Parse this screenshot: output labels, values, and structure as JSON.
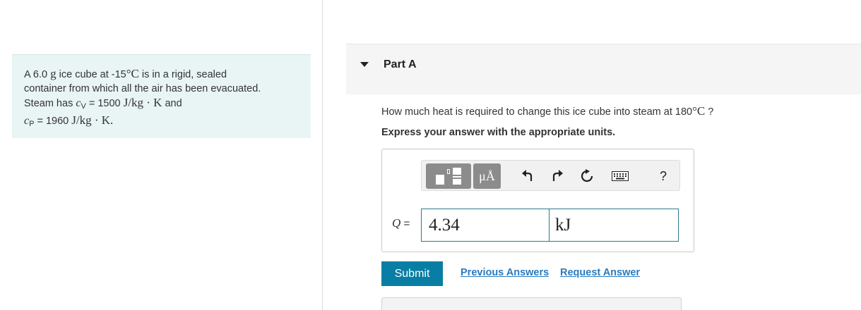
{
  "problem": {
    "line1_pre": "A 6.0",
    "line1_mass_unit": "g",
    "line1_mid": "ice cube at -15",
    "line1_temp_unit": "°C",
    "line1_post": "is in a rigid, sealed",
    "line2": "container from which all the air has been evacuated.",
    "line3_pre": "Steam has",
    "cv_symbol": "c",
    "cv_sub": "V",
    "cv_value": "= 1500",
    "cv_unit": "J/kg · K",
    "line3_post": "and",
    "cp_symbol": "c",
    "cp_sub": "P",
    "cp_value": "= 1960",
    "cp_unit": "J/kg · K."
  },
  "part": {
    "title": "Part A"
  },
  "question": {
    "text_pre": "How much heat is required to change this ice cube into steam at 180",
    "temp_unit": "°C",
    "text_post": "?",
    "instruction": "Express your answer with the appropriate units."
  },
  "toolbar": {
    "templates_icon": "templates-icon",
    "units_label": "μÅ",
    "undo_icon": "undo-icon",
    "redo_icon": "redo-icon",
    "reset_icon": "reset-icon",
    "keyboard_icon": "keyboard-icon",
    "help_label": "?"
  },
  "answer": {
    "variable": "Q",
    "equals": "=",
    "value": "4.34",
    "unit": "kJ"
  },
  "actions": {
    "submit_label": "Submit",
    "previous_answers_label": "Previous Answers",
    "request_answer_label": "Request Answer"
  },
  "colors": {
    "problem_bg": "#e8f5f4",
    "submit_bg": "#087ea4",
    "link": "#2a7bbf",
    "input_border": "#2a7c8c"
  }
}
